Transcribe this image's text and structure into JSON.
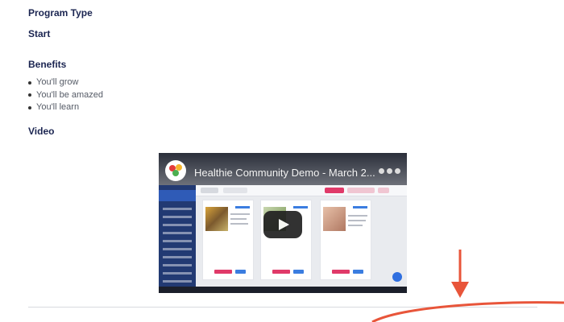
{
  "sections": {
    "program_type": "Program Type",
    "start": "Start",
    "benefits": "Benefits",
    "video": "Video"
  },
  "benefits_list": [
    "You'll grow",
    "You'll be amazed",
    "You'll learn"
  ],
  "video": {
    "title": "Healthie Community Demo - March 2..."
  },
  "colors": {
    "heading": "#1b2551",
    "annotation": "#e8553a",
    "sidebar": "#223a73"
  }
}
